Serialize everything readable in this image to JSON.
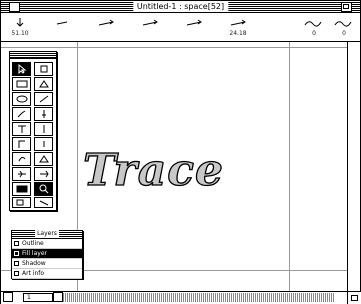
{
  "window": {
    "title": "Untitled-1 : space[52]"
  },
  "toolbar": {
    "items": [
      {
        "name": "tool-1",
        "label": "51.10"
      },
      {
        "name": "tool-2",
        "label": ""
      },
      {
        "name": "tool-3",
        "label": ""
      },
      {
        "name": "tool-4",
        "label": ""
      },
      {
        "name": "tool-5",
        "label": ""
      },
      {
        "name": "tool-6",
        "label": "24.18"
      },
      {
        "name": "tool-7",
        "label": "0"
      },
      {
        "name": "tool-8",
        "label": "0"
      }
    ]
  },
  "canvas": {
    "artwork_text": "Trace"
  },
  "layers_palette": {
    "title": "Layers",
    "rows": [
      {
        "label": "Outline",
        "active": false
      },
      {
        "label": "Fill layer",
        "active": true
      },
      {
        "label": "Shadow",
        "active": false
      },
      {
        "label": "Art info",
        "active": false
      }
    ]
  },
  "statusbar": {
    "page": "1"
  }
}
